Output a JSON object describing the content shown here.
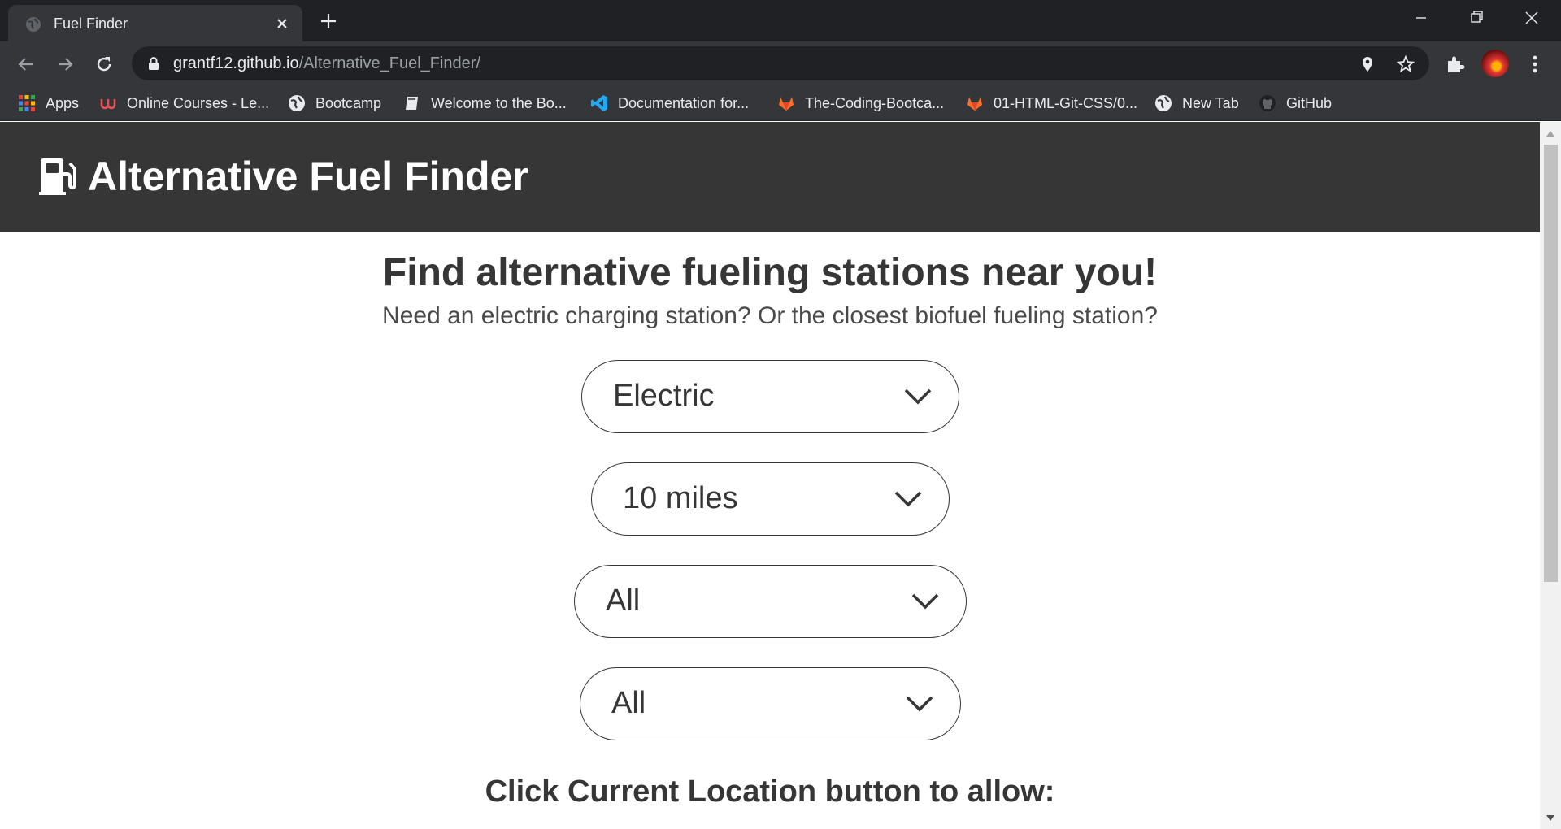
{
  "browser": {
    "tab_title": "Fuel Finder",
    "url_host": "grantf12.github.io",
    "url_path": "/Alternative_Fuel_Finder/",
    "bookmarks": [
      {
        "label": "Apps",
        "icon": "apps-grid-icon"
      },
      {
        "label": "Online Courses - Le...",
        "icon": "udemy-icon"
      },
      {
        "label": "Bootcamp",
        "icon": "globe-icon"
      },
      {
        "label": "Welcome to the Bo...",
        "icon": "book-icon"
      },
      {
        "label": "Documentation for...",
        "icon": "vscode-icon"
      },
      {
        "label": "The-Coding-Bootca...",
        "icon": "gitlab-icon"
      },
      {
        "label": "01-HTML-Git-CSS/0...",
        "icon": "gitlab-icon"
      },
      {
        "label": "New Tab",
        "icon": "globe-icon"
      },
      {
        "label": "GitHub",
        "icon": "github-icon"
      }
    ]
  },
  "site": {
    "title": "Alternative Fuel Finder",
    "icon": "gas-pump-icon"
  },
  "main": {
    "headline": "Find alternative fueling stations near you!",
    "subhead": "Need an electric charging station? Or the closest biofuel fueling station?",
    "selects": [
      {
        "value": "Electric"
      },
      {
        "value": "10 miles"
      },
      {
        "value": "All"
      },
      {
        "value": "All"
      }
    ],
    "location_prompt": "Click Current Location button to allow:"
  },
  "colors": {
    "header_bg": "#363636",
    "text_dark": "#363636"
  }
}
